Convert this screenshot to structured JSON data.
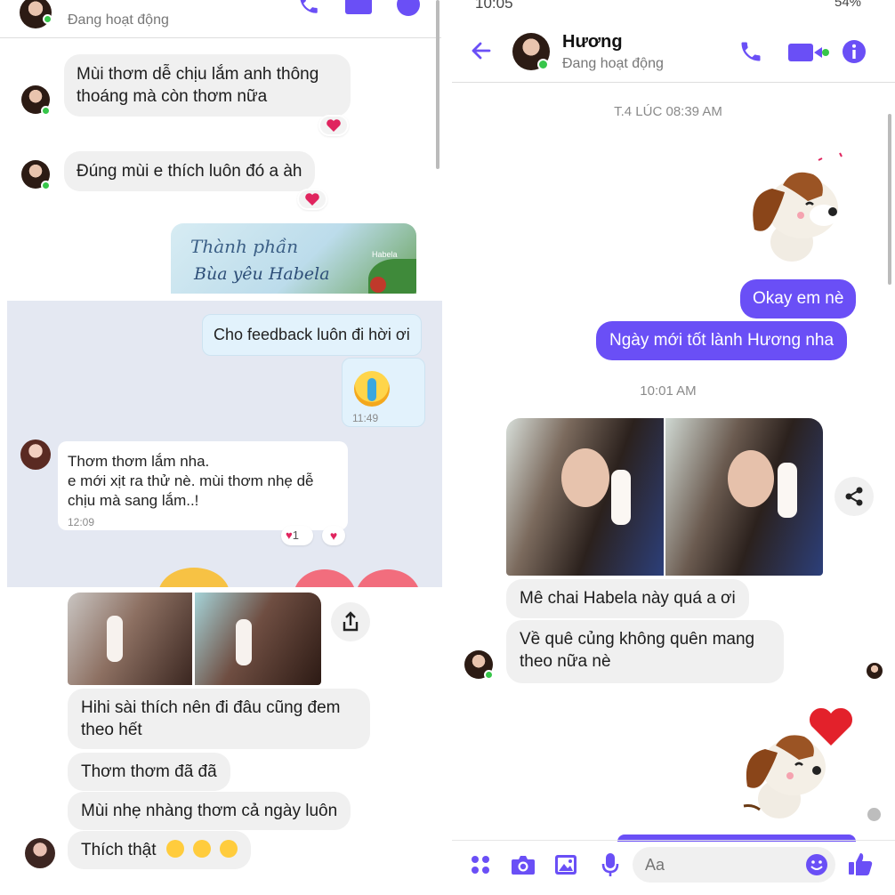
{
  "left": {
    "top_panel": {
      "status": "Đang hoạt động",
      "messages": [
        "Mùi thơm dễ chịu lắm anh thông thoáng mà còn thơm nữa",
        "Đúng mùi e thích luôn đó a àh"
      ],
      "banner_line1": "Thành phần",
      "banner_line2": "Bùa yêu Habela",
      "banner_small": "Habela"
    },
    "middle_panel": {
      "out_message": "Cho feedback luôn đi hời ơi",
      "sticker_time": "11:49",
      "in_message_line1": "Thơm thơm lắm nha.",
      "in_message_line2": "e mới xịt ra thử nè. mùi thơm nhẹ dễ",
      "in_message_line3": "chịu mà sang lắm..!",
      "in_time": "12:09",
      "reaction_count": "1"
    },
    "bottom_panel": {
      "messages": [
        "Hihi sài thích nên đi đâu cũng đem theo hết",
        "Thơm thơm đã đã",
        "Mùi nhẹ nhàng thơm cả ngày luôn",
        "Thích thật"
      ]
    }
  },
  "right": {
    "status_bar": {
      "time": "10:05",
      "battery": "54%"
    },
    "header": {
      "name": "Hương",
      "status": "Đang hoạt động"
    },
    "timestamps": [
      "T.4 LÚC 08:39 AM",
      "10:01 AM"
    ],
    "out_messages": [
      "Okay em nè",
      "Ngày mới tốt lành Hương nha"
    ],
    "in_messages": [
      "Mê chai Habela này quá a ơi",
      "Về quê củng không quên mang theo nữa nè"
    ],
    "composer": {
      "placeholder": "Aa"
    }
  },
  "colors": {
    "messenger_purple": "#6a4ff6",
    "online_green": "#37c64a",
    "heart_red": "#e0245e"
  }
}
